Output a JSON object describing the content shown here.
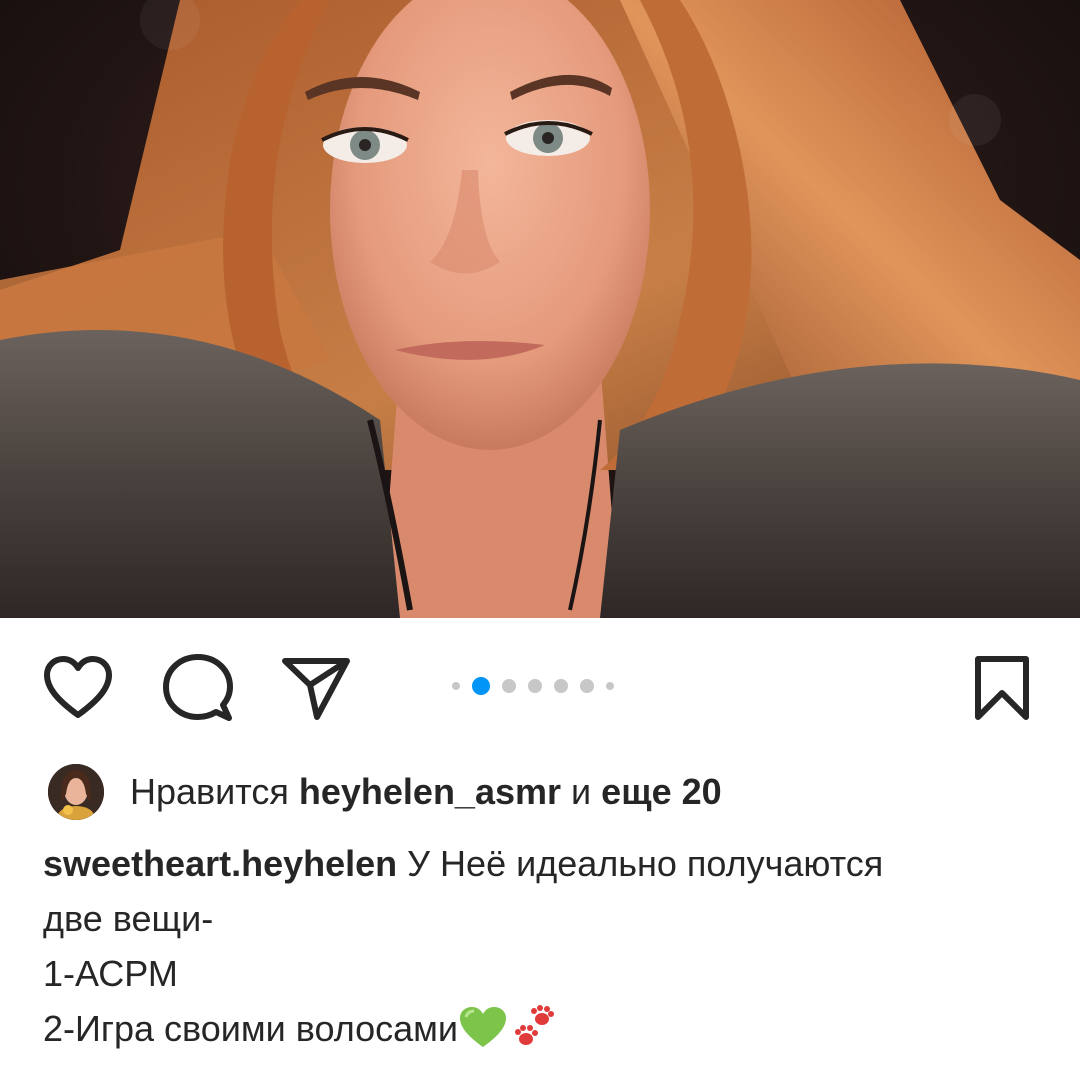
{
  "post": {
    "image_alt": "Portrait photo of a woman with long auburn hair in a fur collar",
    "carousel": {
      "total": 7,
      "active_index": 1
    }
  },
  "actions": {
    "like_icon": "heart-outline-icon",
    "comment_icon": "comment-bubble-icon",
    "share_icon": "paper-plane-icon",
    "save_icon": "bookmark-icon",
    "active_dot_color": "#0095f6"
  },
  "likes": {
    "prefix": "Нравится",
    "user": "heyhelen_asmr",
    "joiner": "и",
    "more": "еще 20"
  },
  "caption": {
    "username": "sweetheart.heyhelen",
    "line1": "У Неё идеально получаются",
    "line2": "две вещи-",
    "line3": "1-АСРМ",
    "line4": "2-Игра своими волосами",
    "emoji1": "green-heart-emoji",
    "emoji2": "paw-prints-emoji"
  }
}
